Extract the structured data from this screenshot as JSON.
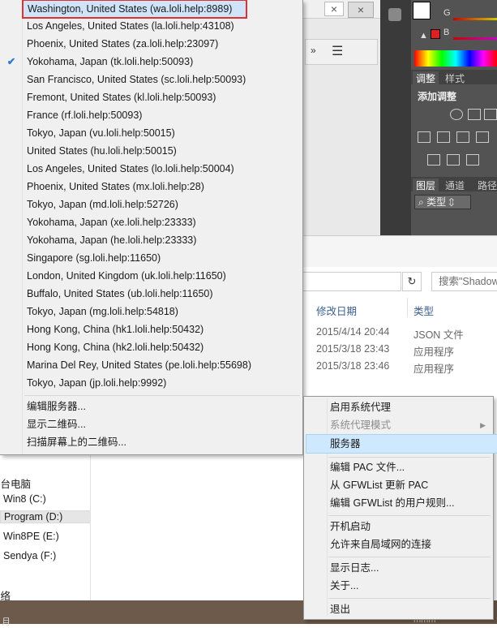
{
  "photoshop": {
    "labels": {
      "g": "G",
      "b": "B"
    },
    "tabs": [
      "调整",
      "样式"
    ],
    "adjust_title": "添加调整",
    "layer_tabs": [
      "图层",
      "通道",
      "路径"
    ],
    "type_label": "类型"
  },
  "explorer": {
    "search_placeholder": "搜索\"Shadow",
    "headers": [
      "修改日期",
      "类型"
    ],
    "rows": [
      {
        "date": "2015/4/14 20:44",
        "type": "JSON 文件"
      },
      {
        "date": "2015/3/18 23:43",
        "type": "应用程序"
      },
      {
        "date": "2015/3/18 23:46",
        "type": "应用程序"
      }
    ]
  },
  "nav": {
    "this_pc": "这台电脑",
    "drives": [
      "Win8 (C:)",
      "Program (D:)",
      "Win8PE (E:)",
      "Sendya (F:)"
    ],
    "network": "网络"
  },
  "server_menu": {
    "servers": [
      "Washington, United States (wa.loli.help:8989)",
      "Los Angeles, United States (la.loli.help:43108)",
      "Phoenix, United States (za.loli.help:23097)",
      "Yokohama, Japan (tk.loli.help:50093)",
      "San Francisco, United States (sc.loli.help:50093)",
      "Fremont, United States (kl.loli.help:50093)",
      "France (rf.loli.help:50093)",
      "Tokyo, Japan (vu.loli.help:50015)",
      "United States (hu.loli.help:50015)",
      "Los Angeles, United States (lo.loli.help:50004)",
      "Phoenix, United States (mx.loli.help:28)",
      "Tokyo, Japan (md.loli.help:52726)",
      "Yokohama, Japan (xe.loli.help:23333)",
      "Yokohama, Japan (he.loli.help:23333)",
      "Singapore (sg.loli.help:11650)",
      "London, United Kingdom (uk.loli.help:11650)",
      "Buffalo, United States (ub.loli.help:11650)",
      "Tokyo, Japan (mg.loli.help:54818)",
      "Hong Kong, China (hk1.loli.help:50432)",
      "Hong Kong, China (hk2.loli.help:50432)",
      "Marina Del Rey, United States (pe.loli.help:55698)",
      "Tokyo, Japan (jp.loli.help:9992)"
    ],
    "checked_index": 3,
    "actions": [
      "编辑服务器...",
      "显示二维码...",
      "扫描屏幕上的二维码..."
    ]
  },
  "tray_menu": {
    "enable_proxy": "启用系统代理",
    "proxy_mode": "系统代理模式",
    "servers": "服务器",
    "edit_pac": "编辑 PAC 文件...",
    "update_pac": "从 GFWList 更新 PAC",
    "edit_rules": "编辑 GFWList 的用户规则...",
    "autostart": "开机启动",
    "allow_lan": "允许来自局域网的连接",
    "show_log": "显示日志...",
    "about": "关于...",
    "quit": "退出"
  },
  "taskbar": {
    "left": "月",
    "right": "mmm"
  },
  "colors": {
    "highlight_border": "#e03030",
    "menu_highlight": "#cde8ff",
    "check": "#2d7cd3"
  }
}
